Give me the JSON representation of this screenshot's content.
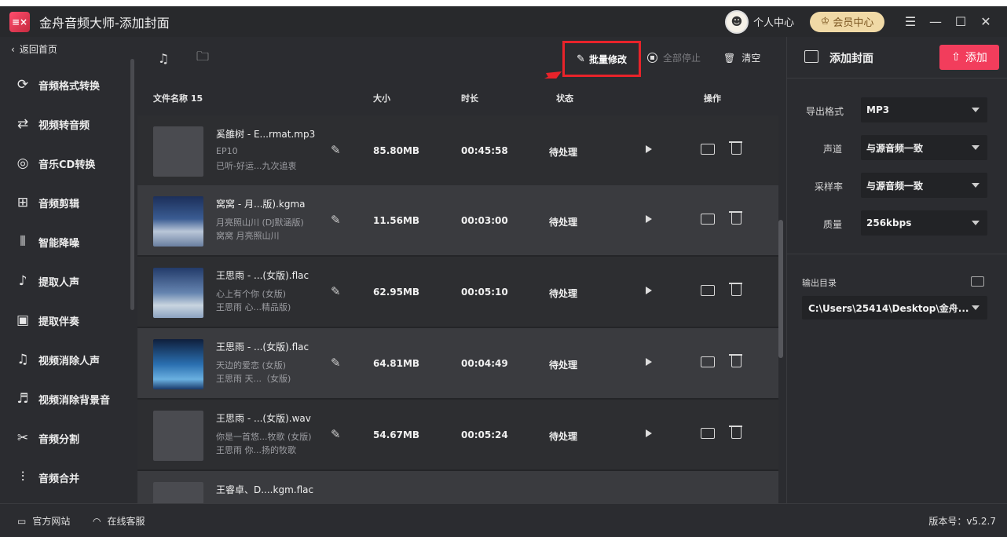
{
  "app": {
    "title": "金舟音频大师-添加封面",
    "logo_text": "≡×"
  },
  "header": {
    "personal_center": "个人中心",
    "vip_center": "会员中心",
    "menu_icon": "menu-icon",
    "minimize_icon": "minimize-icon",
    "maximize_icon": "maximize-icon",
    "close_icon": "close-icon"
  },
  "sidebar": {
    "back_label": "返回首页",
    "items": [
      {
        "label": "音频格式转换",
        "icon": "audio-convert-icon"
      },
      {
        "label": "视频转音频",
        "icon": "video-to-audio-icon"
      },
      {
        "label": "音乐CD转换",
        "icon": "cd-icon"
      },
      {
        "label": "音频剪辑",
        "icon": "audio-cut-icon"
      },
      {
        "label": "智能降噪",
        "icon": "denoise-icon"
      },
      {
        "label": "提取人声",
        "icon": "extract-vocal-icon"
      },
      {
        "label": "提取伴奏",
        "icon": "extract-accompaniment-icon"
      },
      {
        "label": "视频消除人声",
        "icon": "video-remove-vocal-icon"
      },
      {
        "label": "视频消除背景音",
        "icon": "video-remove-bg-icon"
      },
      {
        "label": "音频分割",
        "icon": "audio-split-icon"
      },
      {
        "label": "音频合并",
        "icon": "audio-merge-icon"
      }
    ]
  },
  "toolbar": {
    "batch_edit": "批量修改",
    "stop_all": "全部停止",
    "clear": "清空"
  },
  "table": {
    "headers": {
      "name": "文件名称 15",
      "size": "大小",
      "duration": "时长",
      "status": "状态",
      "actions": "操作"
    },
    "rows": [
      {
        "name": "奚雒树 - E...rmat.mp3",
        "sub1": "EP10",
        "sub2": "已听-好运...九次追衷",
        "size": "85.80MB",
        "duration": "00:45:58",
        "status": "待处理"
      },
      {
        "name": "窝窝 - 月...版).kgma",
        "sub1": "月亮照山川 (DJ默涵版)",
        "sub2": "窝窝  月亮照山川",
        "size": "11.56MB",
        "duration": "00:03:00",
        "status": "待处理"
      },
      {
        "name": "王思雨 - ...(女版).flac",
        "sub1": "心上有个你 (女版)",
        "sub2": "王思雨  心...精品版)",
        "size": "62.95MB",
        "duration": "00:05:10",
        "status": "待处理"
      },
      {
        "name": "王思雨 - ...(女版).flac",
        "sub1": "天边的爱恋 (女版)",
        "sub2": "王思雨  天...（女版)",
        "size": "64.81MB",
        "duration": "00:04:49",
        "status": "待处理"
      },
      {
        "name": "王思雨 - ...(女版).wav",
        "sub1": "你是一首悠...牧歌 (女版)",
        "sub2": "王思雨  你...扬的牧歌",
        "size": "54.67MB",
        "duration": "00:05:24",
        "status": "待处理"
      },
      {
        "name": "王睿卓、D....kgm.flac",
        "sub1": "",
        "sub2": "",
        "size": "",
        "duration": "",
        "status": ""
      }
    ]
  },
  "right_panel": {
    "title": "添加封面",
    "add_button": "添加",
    "export_format_label": "导出格式",
    "export_format_value": "MP3",
    "channel_label": "声道",
    "channel_value": "与源音频一致",
    "sample_rate_label": "采样率",
    "sample_rate_value": "与源音频一致",
    "quality_label": "质量",
    "quality_value": "256kbps",
    "output_dir_label": "输出目录",
    "output_dir_value": "C:\\Users\\25414\\Desktop\\金舟..."
  },
  "footer": {
    "website": "官方网站",
    "support": "在线客服",
    "version": "版本号：v5.2.7"
  },
  "colors": {
    "accent": "#f23d5c",
    "highlight_box": "#e8232a",
    "vip": "#f0d9a6"
  }
}
